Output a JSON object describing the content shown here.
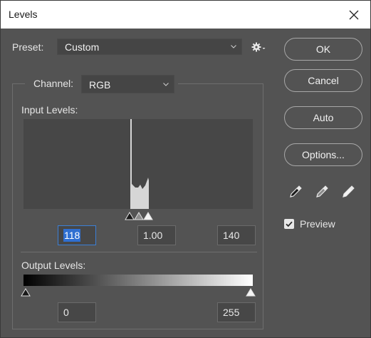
{
  "window": {
    "title": "Levels"
  },
  "preset": {
    "label": "Preset:",
    "value": "Custom"
  },
  "buttons": {
    "ok": "OK",
    "cancel": "Cancel",
    "auto": "Auto",
    "options": "Options..."
  },
  "channel": {
    "label": "Channel:",
    "value": "RGB"
  },
  "input_levels": {
    "label": "Input Levels:",
    "shadow": "118",
    "midtone": "1.00",
    "highlight": "140"
  },
  "output_levels": {
    "label": "Output Levels:",
    "low": "0",
    "high": "255"
  },
  "preview": {
    "label": "Preview",
    "checked": true
  },
  "colors": {
    "dialog_bg": "#535353",
    "titlebar_bg": "#ffffff",
    "selection": "#2f6fd1",
    "histogram_fill": "#d6d6d6"
  },
  "icons": [
    "close-icon",
    "gear-icon",
    "chevron-down-icon",
    "eyedropper-black-icon",
    "eyedropper-gray-icon",
    "eyedropper-white-icon",
    "checkmark-icon"
  ]
}
